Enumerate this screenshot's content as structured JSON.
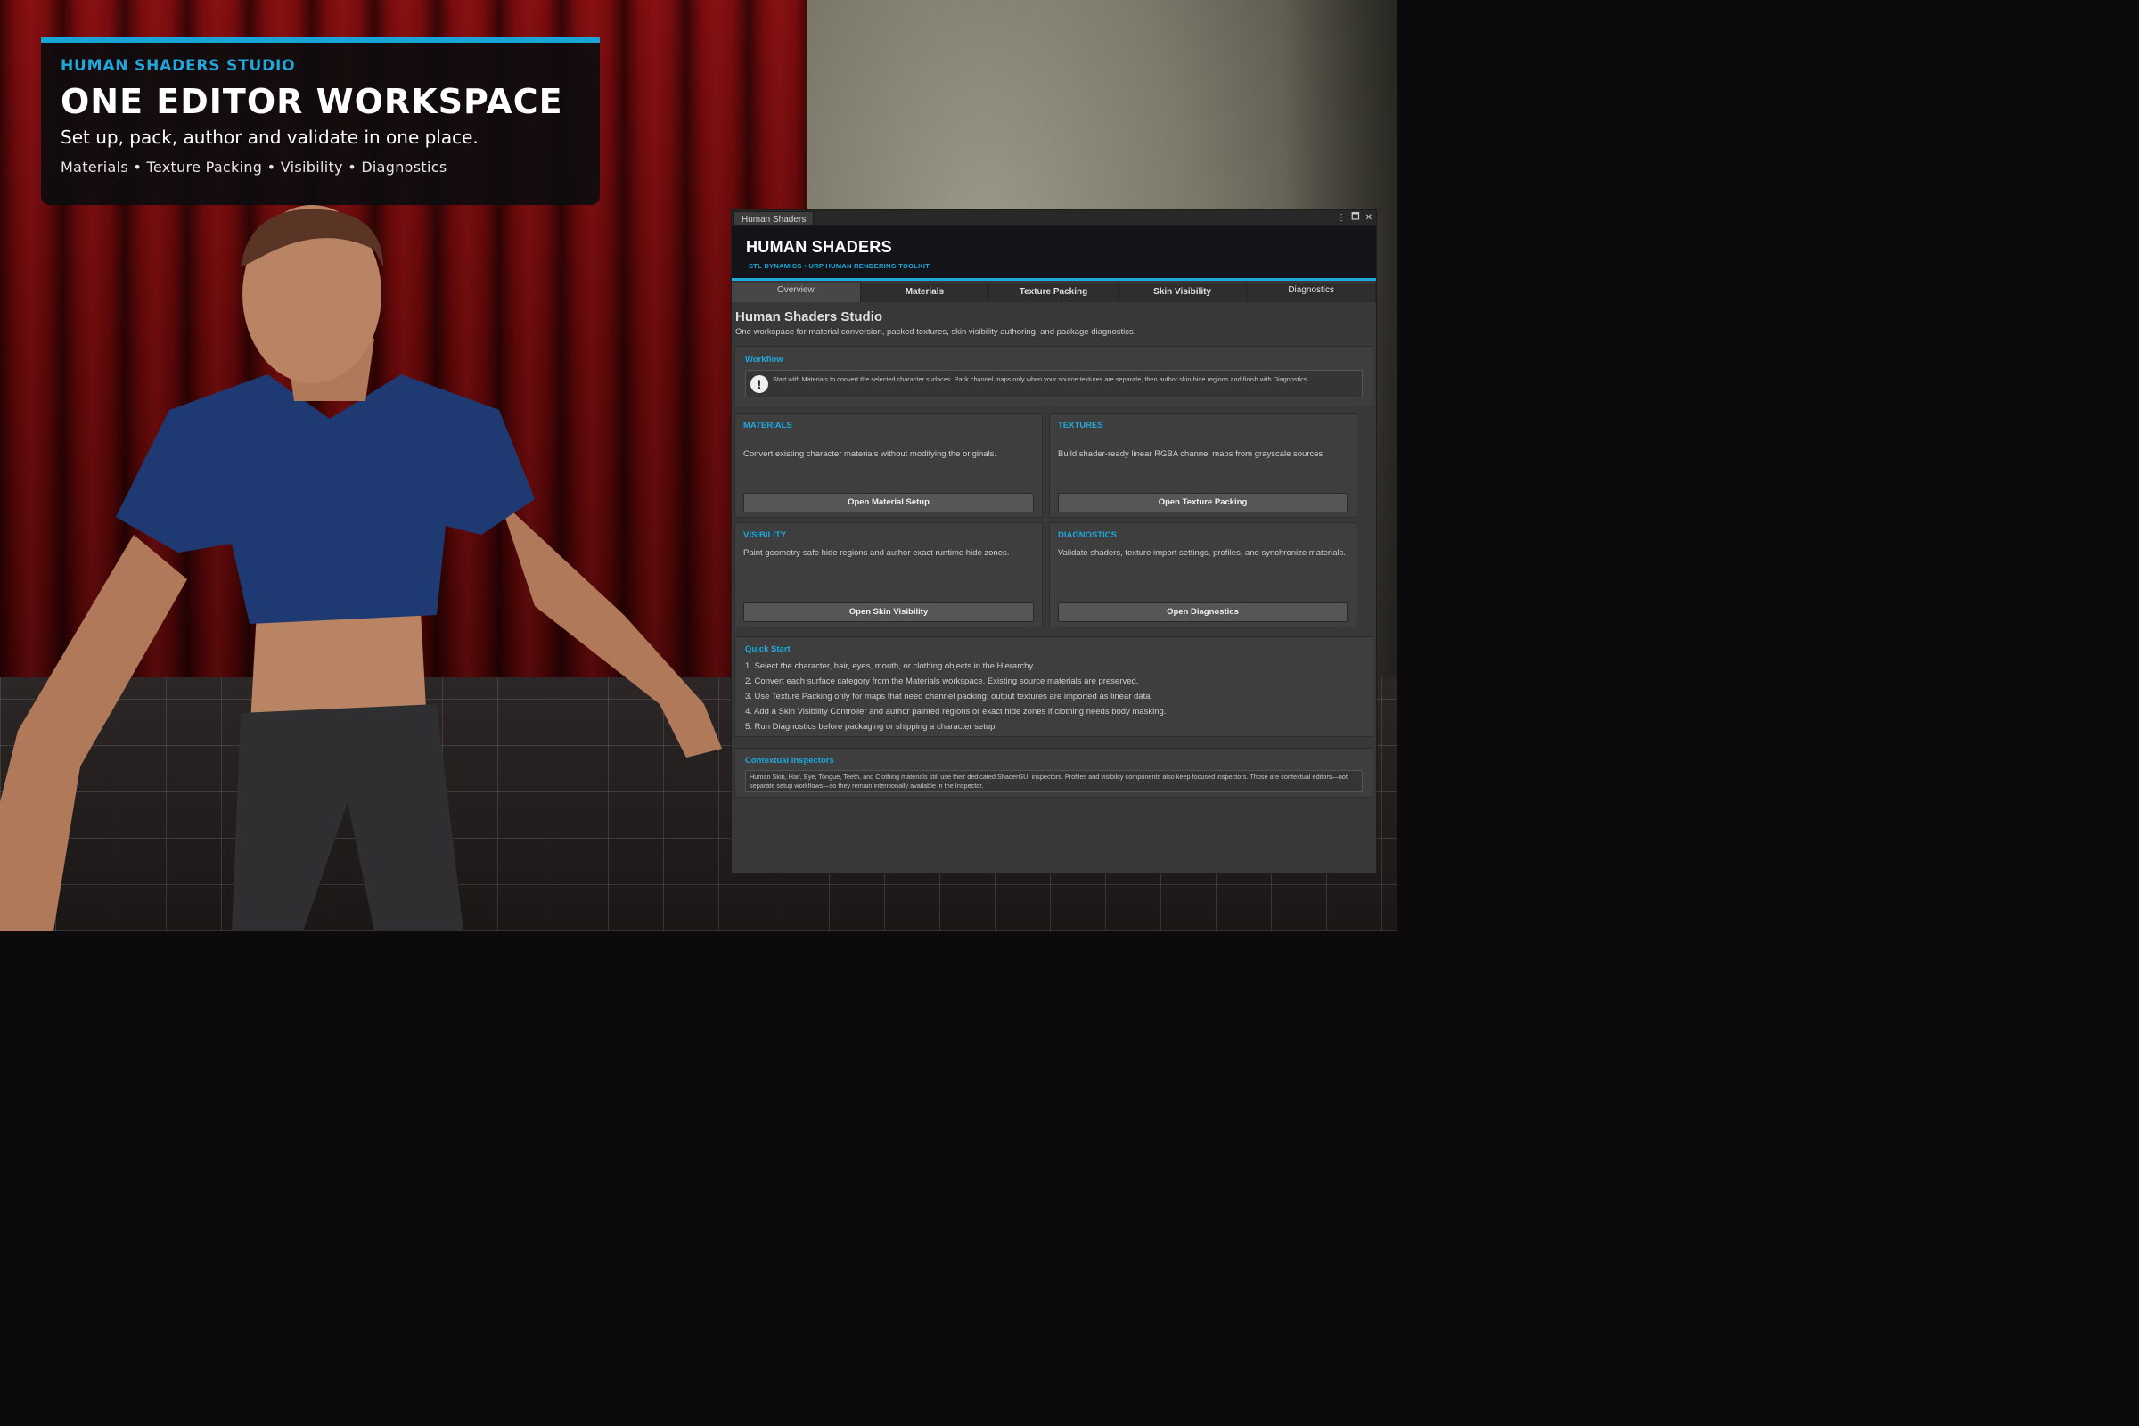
{
  "hero": {
    "eyebrow": "HUMAN SHADERS STUDIO",
    "title": "ONE EDITOR WORKSPACE",
    "subtitle": "Set up, pack, author and validate in one place.",
    "tags": "Materials • Texture Packing • Visibility • Diagnostics"
  },
  "window": {
    "tab_title": "Human Shaders",
    "controls": {
      "menu": "⋮",
      "maximize": "🗖",
      "close": "✕"
    },
    "banner_title": "HUMAN SHADERS",
    "banner_sub": "STL DYNAMICS • URP HUMAN RENDERING TOOLKIT",
    "tabs": [
      "Overview",
      "Materials",
      "Texture Packing",
      "Skin Visibility",
      "Diagnostics"
    ],
    "active_tab": "Overview",
    "studio_title": "Human Shaders Studio",
    "studio_desc": "One workspace for material conversion, packed textures, skin visibility authoring, and package diagnostics.",
    "workflow": {
      "heading": "Workflow",
      "text": "Start with Materials to convert the selected character surfaces. Pack channel maps only when your source textures are separate, then author skin-hide regions and finish with Diagnostics."
    },
    "cards": [
      {
        "heading": "MATERIALS",
        "text": "Convert existing character materials without modifying the originals.",
        "button": "Open Material Setup"
      },
      {
        "heading": "TEXTURES",
        "text": "Build shader-ready linear RGBA channel maps from grayscale sources.",
        "button": "Open Texture Packing"
      },
      {
        "heading": "VISIBILITY",
        "text": "Paint geometry-safe hide regions and author exact runtime hide zones.",
        "button": "Open Skin Visibility"
      },
      {
        "heading": "DIAGNOSTICS",
        "text": "Validate shaders, texture import settings, profiles, and synchronize materials.",
        "button": "Open Diagnostics"
      }
    ],
    "quick_start": {
      "heading": "Quick Start",
      "items": [
        "1. Select the character, hair, eyes, mouth, or clothing objects in the Hierarchy.",
        "2. Convert each surface category from the Materials workspace. Existing source materials are preserved.",
        "3. Use Texture Packing only for maps that need channel packing; output textures are imported as linear data.",
        "4. Add a Skin Visibility Controller and author painted regions or exact hide zones if clothing needs body masking.",
        "5. Run Diagnostics before packaging or shipping a character setup."
      ]
    },
    "contextual": {
      "heading": "Contextual Inspectors",
      "text": "Human Skin, Hair, Eye, Tongue, Teeth, and Clothing materials still use their dedicated ShaderGUI inspectors. Profiles and visibility components also keep focused inspectors. Those are contextual editors—not separate setup workflows—so they remain intentionally available in the Inspector."
    }
  }
}
